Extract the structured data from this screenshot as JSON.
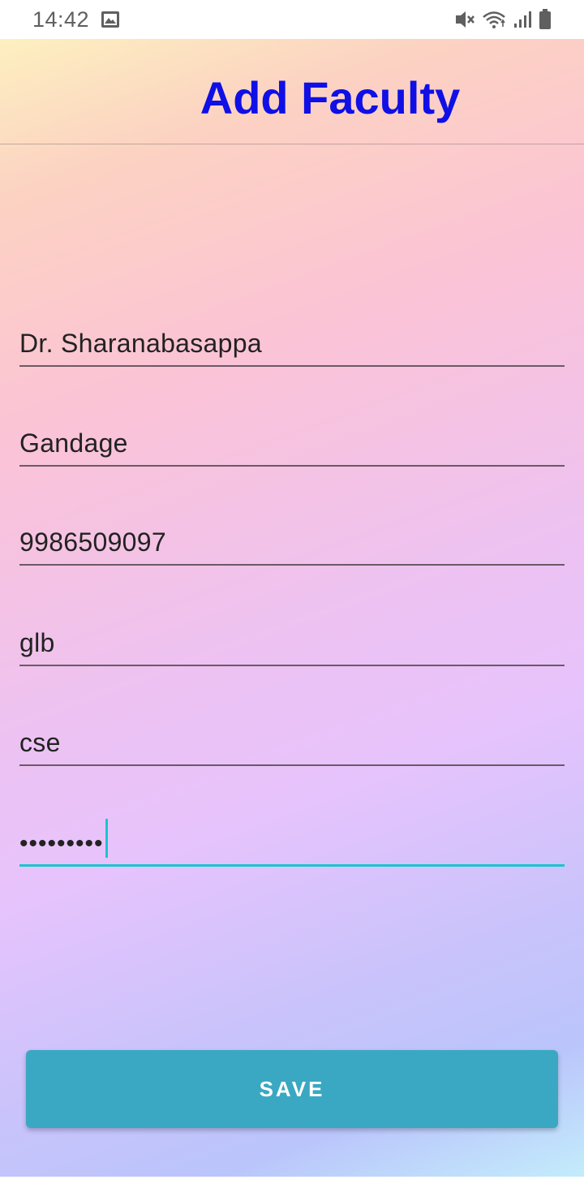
{
  "status_bar": {
    "time": "14:42",
    "icons": [
      "image-icon",
      "mute-icon",
      "wifi-icon",
      "signal-icon",
      "battery-icon"
    ]
  },
  "header": {
    "title": "Add Faculty",
    "title_color": "#0f0fe6"
  },
  "form": {
    "fields": [
      {
        "name": "first-name",
        "value": "Dr. Sharanabasappa"
      },
      {
        "name": "last-name",
        "value": "Gandage"
      },
      {
        "name": "phone",
        "value": "9986509097"
      },
      {
        "name": "college",
        "value": "glb"
      },
      {
        "name": "department",
        "value": "cse"
      },
      {
        "name": "password",
        "value": "•••••••••",
        "focused": true
      }
    ],
    "accent_color": "#18c6cf"
  },
  "actions": {
    "save_label": "SAVE",
    "save_color": "#3aa8c2"
  }
}
